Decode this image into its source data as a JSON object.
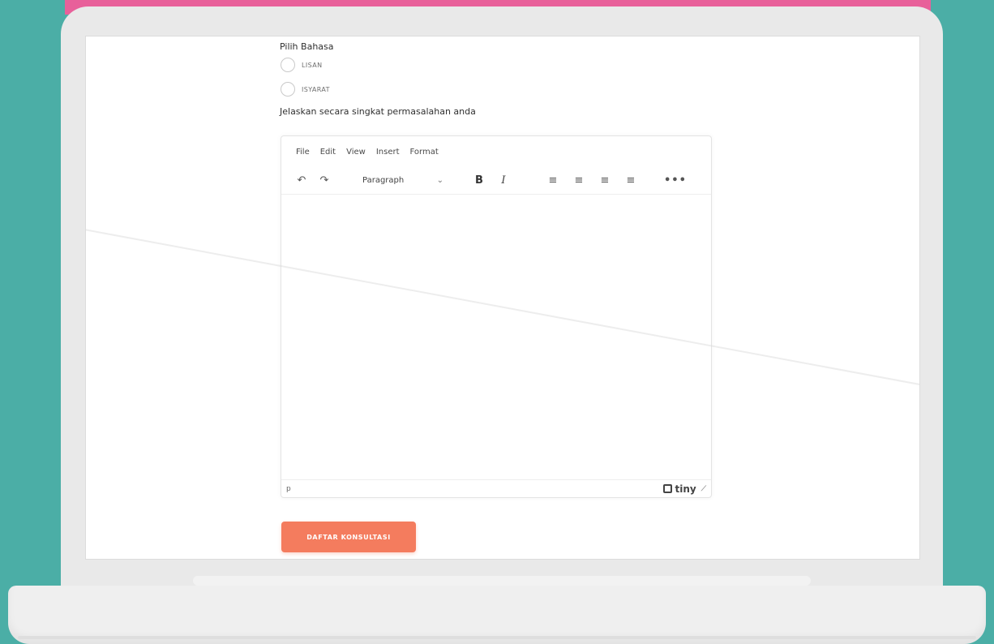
{
  "form": {
    "language_label": "Pilih Bahasa",
    "options": [
      "LISAN",
      "ISYARAT"
    ],
    "problem_label": "Jelaskan secara singkat permasalahan anda"
  },
  "editor": {
    "menu": [
      "File",
      "Edit",
      "View",
      "Insert",
      "Format"
    ],
    "toolbar": {
      "undo": "↶",
      "redo": "↷",
      "block_format": "Paragraph",
      "chevron": "⌄",
      "bold": "B",
      "italic": "I",
      "align_left": "≡",
      "align_center": "≡",
      "align_right": "≡",
      "justify": "≡",
      "more": "•••"
    },
    "statusbar": {
      "path": "p",
      "brand": "tiny",
      "resize": "⟋"
    }
  },
  "submit_label": "DAFTAR KONSULTASI",
  "colors": {
    "background": "#4baea6",
    "accent_pink": "#e8609a",
    "button": "#f47c5e"
  }
}
